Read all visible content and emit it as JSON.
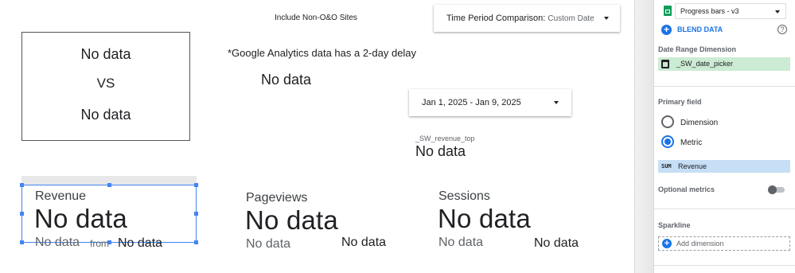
{
  "canvas": {
    "filter_label": "Include Non-O&O Sites",
    "time_period": {
      "label": "Time Period Comparison",
      "value": "Custom Date"
    },
    "date_range": "Jan 1, 2025 - Jan 9, 2025",
    "delay_note": "*Google Analytics data has a 2-day delay",
    "compare_box": {
      "top": "No data",
      "vs": "VS",
      "bottom": "No data"
    },
    "center_value": "No data",
    "revenue_top": {
      "label": "_SW_revenue_top",
      "value": "No data"
    },
    "scorecards": [
      {
        "label": "Revenue",
        "value": "No data",
        "sub_left": "No data",
        "sub_mid": "from",
        "sub_right": "No data"
      },
      {
        "label": "Pageviews",
        "value": "No data",
        "sub_left": "No data",
        "sub_right": "No data"
      },
      {
        "label": "Sessions",
        "value": "No data",
        "sub_left": "No data",
        "sub_right": "No data"
      }
    ]
  },
  "panel": {
    "datasource": "Progress bars - v3",
    "blend_label": "BLEND DATA",
    "date_range_dim_title": "Date Range Dimension",
    "date_range_dim_value": "_SW_date_picker",
    "primary_field_title": "Primary field",
    "options": [
      "Dimension",
      "Metric"
    ],
    "selected_option": "Metric",
    "metric_agg": "SUM",
    "metric_name": "Revenue",
    "optional_metrics_title": "Optional metrics",
    "sparkline_title": "Sparkline",
    "add_dimension_label": "Add dimension",
    "colors": {
      "accent": "#1a73e8",
      "dimension_chip": "#ccebd3",
      "metric_chip": "#c6dff6",
      "sheets_green": "#0f9d58"
    }
  }
}
